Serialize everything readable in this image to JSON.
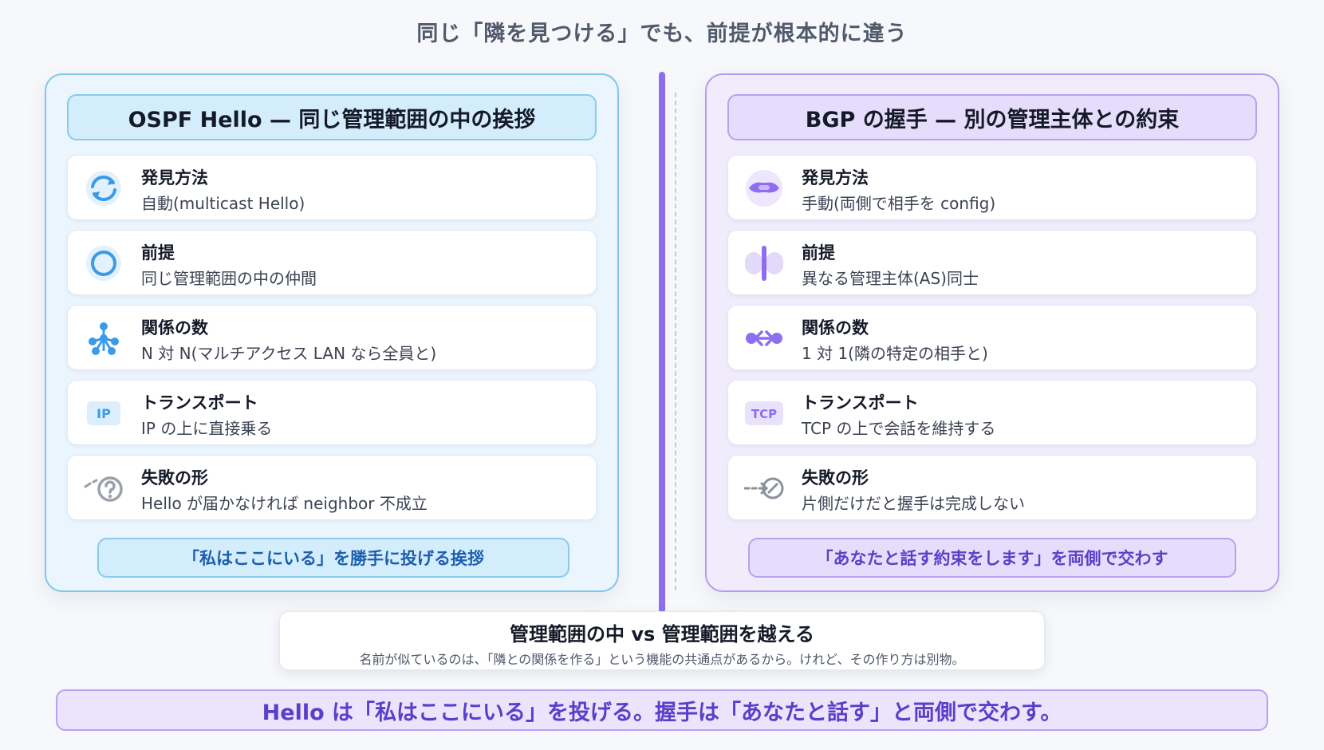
{
  "title": "同じ「隣を見つける」でも、前提が根本的に違う",
  "ospf": {
    "header": "OSPF Hello — 同じ管理範囲の中の挨拶",
    "rows": [
      {
        "label": "発見方法",
        "value": "自動(multicast Hello)",
        "icon": "refresh-arrows-icon"
      },
      {
        "label": "前提",
        "value": "同じ管理範囲の中の仲間",
        "icon": "circle-icon"
      },
      {
        "label": "関係の数",
        "value": "N 対 N(マルチアクセス LAN なら全員と)",
        "icon": "network-nodes-icon"
      },
      {
        "label": "トランスポート",
        "value": "IP の上に直接乗る",
        "icon": "ip-icon",
        "icon_text": "IP"
      },
      {
        "label": "失敗の形",
        "value": "Hello が届かなければ neighbor 不成立",
        "icon": "question-icon"
      }
    ],
    "footer": "「私はここにいる」を勝手に投げる挨拶"
  },
  "bgp": {
    "header": "BGP の握手 — 別の管理主体との約束",
    "rows": [
      {
        "label": "発見方法",
        "value": "手動(両側で相手を config)",
        "icon": "handshake-icon"
      },
      {
        "label": "前提",
        "value": "異なる管理主体(AS)同士",
        "icon": "split-boundary-icon"
      },
      {
        "label": "関係の数",
        "value": "1 対 1(隣の特定の相手と)",
        "icon": "bidirectional-arrow-icon"
      },
      {
        "label": "トランスポート",
        "value": "TCP の上で会話を維持する",
        "icon": "tcp-icon",
        "icon_text": "TCP"
      },
      {
        "label": "失敗の形",
        "value": "片側だけだと握手は完成しない",
        "icon": "broken-link-icon"
      }
    ],
    "footer": "「あなたと話す約束をします」を両側で交わす"
  },
  "center": {
    "title": "管理範囲の中 vs 管理範囲を越える",
    "subtitle": "名前が似ているのは、「隣との関係を作る」という機能の共通点があるから。けれど、その作り方は別物。"
  },
  "bottom": "Hello は「私はここにいる」を投げる。握手は「あなたと話す」と両側で交わす。",
  "colors": {
    "ospf_accent": "#3a9be8",
    "bgp_accent": "#8e6ef0",
    "ospf_border": "#82c7ea",
    "bgp_border": "#b49ced"
  }
}
